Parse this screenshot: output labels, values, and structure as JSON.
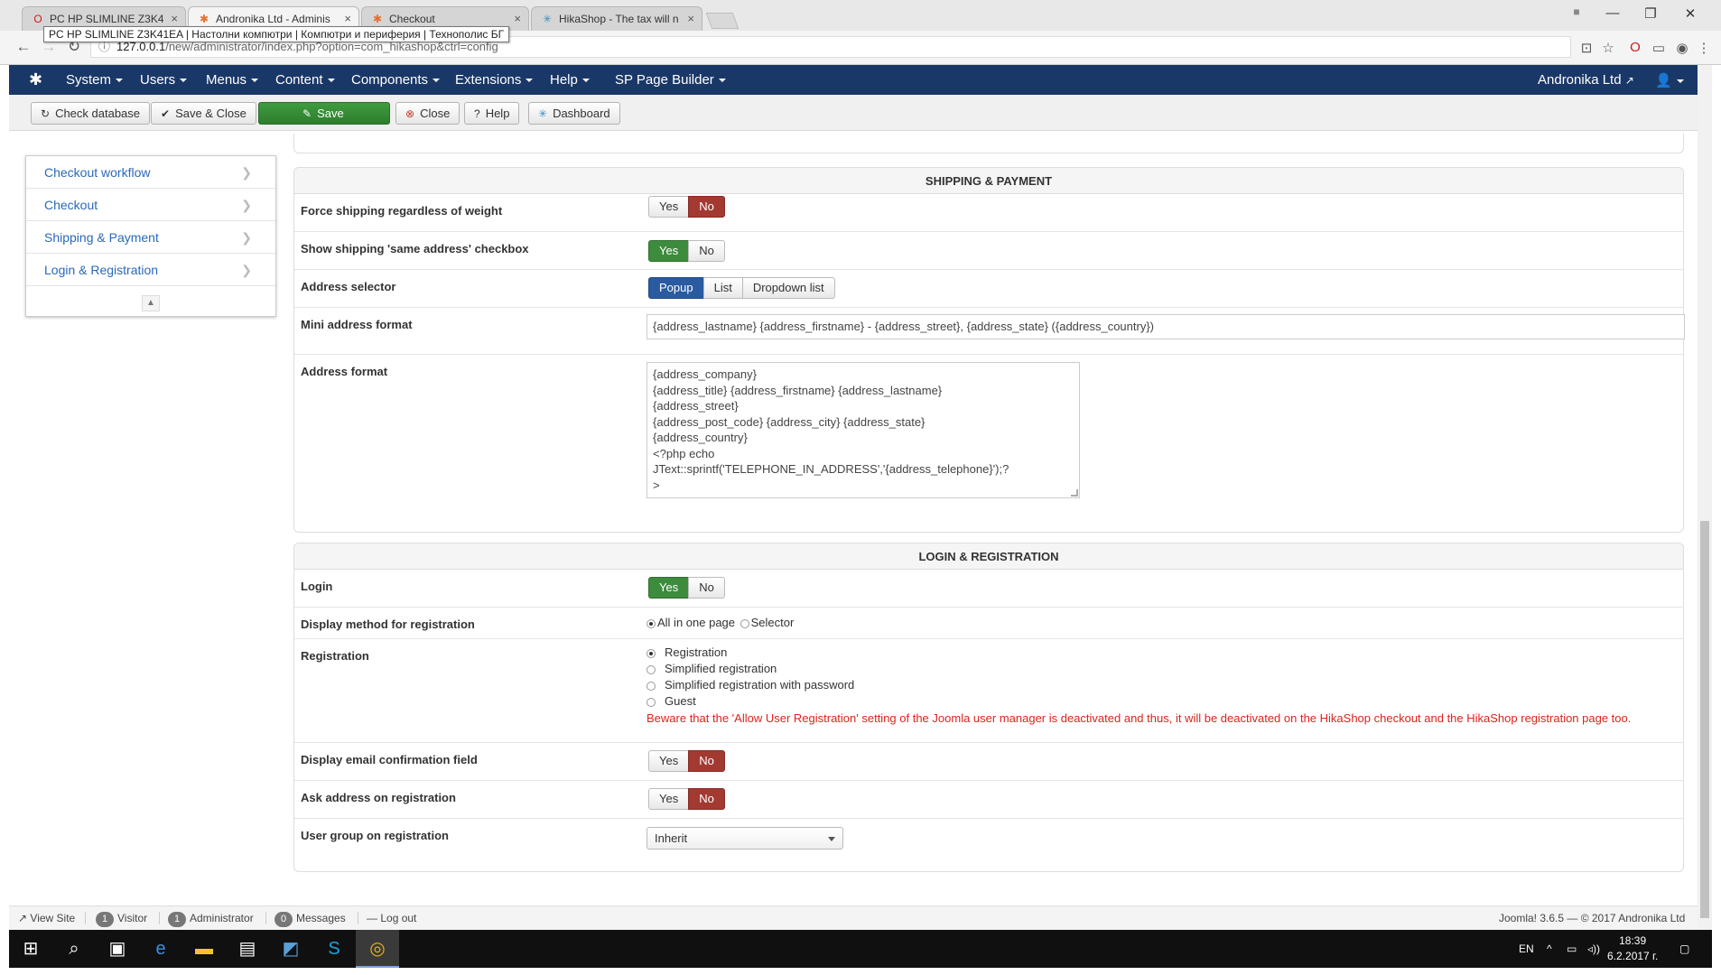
{
  "browser": {
    "tabs": [
      {
        "title": "PC HP SLIMLINE Z3K41E",
        "icon": "opera-icon"
      },
      {
        "title": "Andronika Ltd - Adminis",
        "icon": "joomla-icon"
      },
      {
        "title": "Checkout",
        "icon": "joomla-icon"
      },
      {
        "title": "HikaShop - The tax will n",
        "icon": "hikashop-icon"
      }
    ],
    "tooltip": "PC HP SLIMLINE Z3K41EA | Настолни компютри | Компютри и периферия | Технополис БГ",
    "url_host": "127.0.0.1",
    "url_path": "/new/administrator/index.php?option=com_hikashop&ctrl=config"
  },
  "nav": {
    "menus": [
      "System",
      "Users",
      "Menus",
      "Content",
      "Components",
      "Extensions",
      "Help",
      "SP Page Builder"
    ],
    "site_name": "Andronika Ltd"
  },
  "toolbar": {
    "check_database": "Check database",
    "save_close": "Save & Close",
    "save": "Save",
    "close": "Close",
    "help": "Help",
    "dashboard": "Dashboard"
  },
  "sidebar": {
    "items": [
      "Checkout workflow",
      "Checkout",
      "Shipping & Payment",
      "Login & Registration"
    ]
  },
  "shipping": {
    "title": "SHIPPING & PAYMENT",
    "force_shipping": {
      "label": "Force shipping regardless of weight",
      "yes": "Yes",
      "no": "No",
      "value": "No"
    },
    "same_address": {
      "label": "Show shipping 'same address' checkbox",
      "yes": "Yes",
      "no": "No",
      "value": "Yes"
    },
    "address_selector": {
      "label": "Address selector",
      "options": [
        "Popup",
        "List",
        "Dropdown list"
      ],
      "value": "Popup"
    },
    "mini_address_format": {
      "label": "Mini address format",
      "value": "{address_lastname} {address_firstname} - {address_street}, {address_state} ({address_country})"
    },
    "address_format": {
      "label": "Address format",
      "value": "{address_company}\n{address_title} {address_firstname} {address_lastname}\n{address_street}\n{address_post_code} {address_city} {address_state}\n{address_country}\n<?php echo JText::sprintf('TELEPHONE_IN_ADDRESS','{address_telephone}');?\n>"
    }
  },
  "login": {
    "title": "LOGIN & REGISTRATION",
    "login": {
      "label": "Login",
      "yes": "Yes",
      "no": "No",
      "value": "Yes"
    },
    "display_method": {
      "label": "Display method for registration",
      "options": [
        "All in one page",
        "Selector"
      ],
      "value": "All in one page"
    },
    "registration": {
      "label": "Registration",
      "options": [
        "Registration",
        "Simplified registration",
        "Simplified registration with password",
        "Guest"
      ],
      "value": "Registration",
      "warning": "Beware that the 'Allow User Registration' setting of the Joomla user manager is deactivated and thus, it will be deactivated on the HikaShop checkout and the HikaShop registration page too."
    },
    "email_confirmation": {
      "label": "Display email confirmation field",
      "yes": "Yes",
      "no": "No",
      "value": "No"
    },
    "ask_address": {
      "label": "Ask address on registration",
      "yes": "Yes",
      "no": "No",
      "value": "No"
    },
    "user_group": {
      "label": "User group on registration",
      "value": "Inherit"
    }
  },
  "status": {
    "view_site": "View Site",
    "visitor_count": "1",
    "visitor": "Visitor",
    "admin_count": "1",
    "administrator": "Administrator",
    "messages_count": "0",
    "messages": "Messages",
    "logout": "Log out",
    "version": "Joomla! 3.6.5 — © 2017 Andronika Ltd"
  },
  "taskbar": {
    "lang": "EN",
    "time": "18:39",
    "date": "6.2.2017 г."
  }
}
